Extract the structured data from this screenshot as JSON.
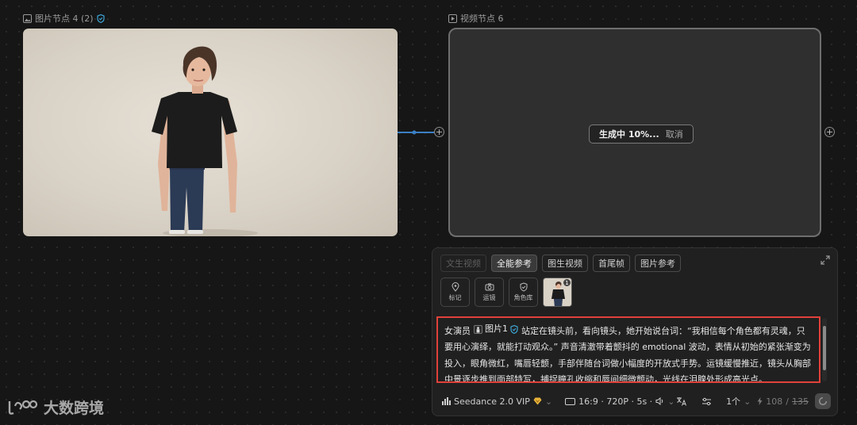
{
  "image_node": {
    "label": "图片节点 4 (2)"
  },
  "video_node": {
    "label": "视频节点 6",
    "status": "生成中 10%...",
    "cancel": "取消"
  },
  "panel": {
    "mode_tabs": [
      {
        "label": "文生视频"
      },
      {
        "label": "全能参考"
      },
      {
        "label": "图生视频"
      },
      {
        "label": "首尾帧"
      },
      {
        "label": "图片参考"
      }
    ],
    "tools": [
      {
        "label": "标记",
        "icon": "location-pin-icon"
      },
      {
        "label": "运镜",
        "icon": "camera-icon"
      },
      {
        "label": "角色库",
        "icon": "shield-icon"
      }
    ],
    "ref_badge": "1",
    "prompt": {
      "before": "女演员",
      "chip_label": "图片1",
      "after": "站定在镜头前，看向镜头，她开始说台词：“我相信每个角色都有灵魂，只要用心演绎，就能打动观众。” 声音清澈带着颤抖的 emotional 波动，表情从初始的紧张渐变为投入，眼角微红，嘴唇轻颤，手部伴随台词做小幅度的开放式手势。运镜缓慢推近，镜头从胸部中景逐步推到面部特写，捕捉瞳孔收缩和唇间细微颤动，光线在泪腺处形成高光点。"
    },
    "model": "Seedance 2.0 VIP",
    "video_spec": "16:9 · 720P · 5s ·",
    "count": "1个",
    "credits_current": "108",
    "credits_total": "135"
  },
  "watermark": {
    "brand": "大数跨境"
  }
}
